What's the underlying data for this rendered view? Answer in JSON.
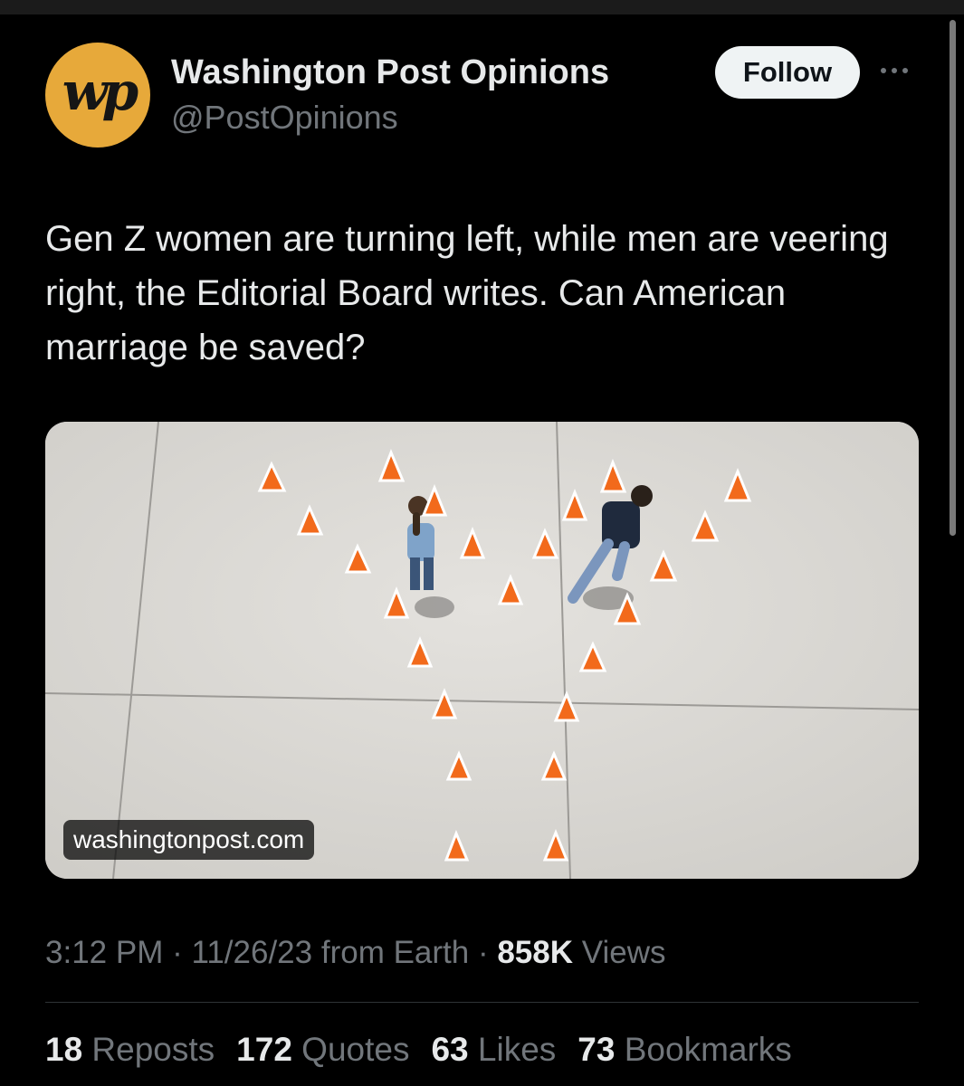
{
  "account": {
    "avatar_text": "wp",
    "name": "Washington Post Opinions",
    "handle": "@PostOpinions",
    "follow_label": "Follow",
    "avatar_color": "#e7a93a"
  },
  "tweet": {
    "text": "Gen Z women are turning left, while men are veering right, the Editorial Board writes. Can American marriage be saved?"
  },
  "media": {
    "domain": "washingtonpost.com"
  },
  "meta": {
    "time": "3:12 PM",
    "sep1": " · ",
    "date": "11/26/23",
    "source": " from Earth",
    "sep2": " · ",
    "views_count": "858K",
    "views_label": " Views"
  },
  "stats": [
    {
      "count": "18",
      "label": " Reposts"
    },
    {
      "count": "172",
      "label": " Quotes"
    },
    {
      "count": "63",
      "label": " Likes"
    },
    {
      "count": "73",
      "label": " Bookmarks"
    }
  ],
  "colors": {
    "background": "#000000",
    "text": "#e7e9ea",
    "secondary": "#71767b",
    "cone": "#f26a1b"
  }
}
